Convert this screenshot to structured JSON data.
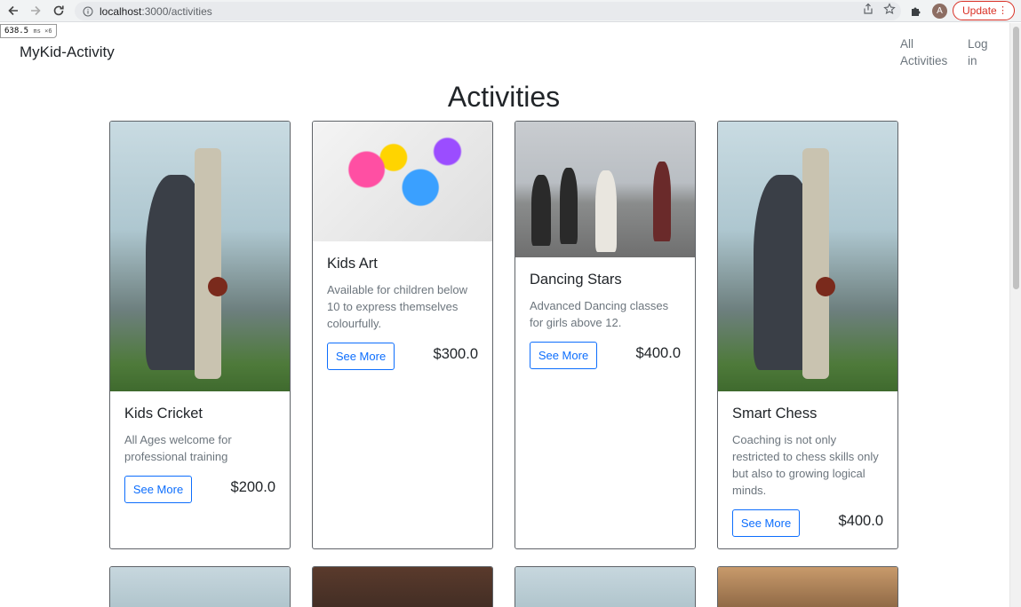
{
  "browser": {
    "url_host": "localhost",
    "url_path": ":3000/activities",
    "update_label": "Update",
    "avatar_letter": "A",
    "perf_value": "638.5",
    "perf_unit": "ms ×6"
  },
  "navbar": {
    "brand": "MyKid-Activity",
    "links": [
      {
        "label": "All Activities"
      },
      {
        "label": "Log in"
      }
    ]
  },
  "page": {
    "title": "Activities"
  },
  "see_more_label": "See More",
  "activities": [
    {
      "title": "Kids Cricket",
      "description": "All Ages welcome for professional training",
      "price": "$200.0",
      "image": "cricket-player-photo"
    },
    {
      "title": "Kids Art",
      "description": "Available for children below 10 to express themselves colourfully.",
      "price": "$300.0",
      "image": "paint-art-photo"
    },
    {
      "title": "Dancing Stars",
      "description": "Advanced Dancing classes for girls above 12.",
      "price": "$400.0",
      "image": "dancing-girls-photo"
    },
    {
      "title": "Smart Chess",
      "description": "Coaching is not only restricted to chess skills only but also to growing logical minds.",
      "price": "$400.0",
      "image": "cricket-player-photo"
    }
  ],
  "colors": {
    "primary": "#0d6efd",
    "text": "#212529",
    "muted": "#6c757d",
    "update_red": "#d93025"
  }
}
